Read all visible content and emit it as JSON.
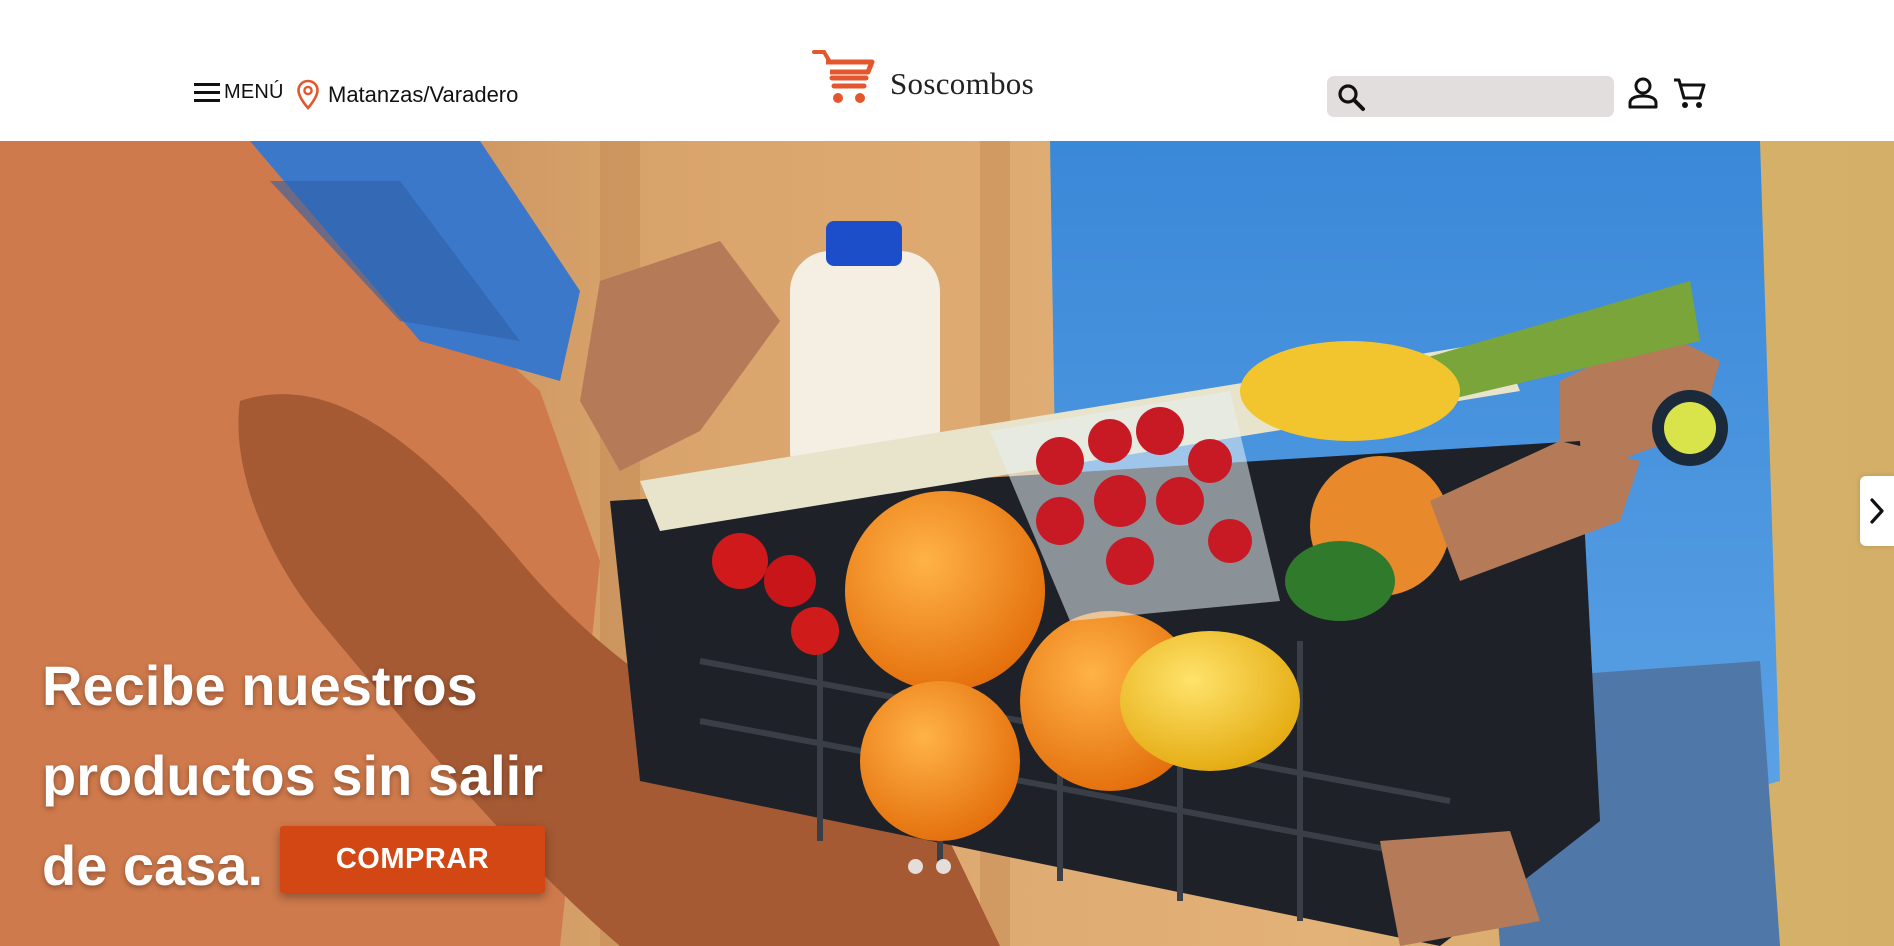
{
  "header": {
    "menu_label": "MENÚ",
    "location_label": "Matanzas/Varadero",
    "brand_name": "Soscombos",
    "search_placeholder": "",
    "icons": {
      "menu": "hamburger-icon",
      "location": "map-pin-icon",
      "logo": "shopping-cart-logo",
      "search": "search-icon",
      "account": "user-icon",
      "cart": "cart-icon"
    },
    "colors": {
      "accent": "#e4572e",
      "search_bg": "#e1dedd"
    }
  },
  "hero": {
    "title_lines": [
      "Recibe nuestros",
      "productos sin salir",
      "de casa."
    ],
    "cta_label": "COMPRAR",
    "cta_color": "#d24713",
    "slide_count": 2,
    "next_icon": "chevron-right-icon"
  }
}
